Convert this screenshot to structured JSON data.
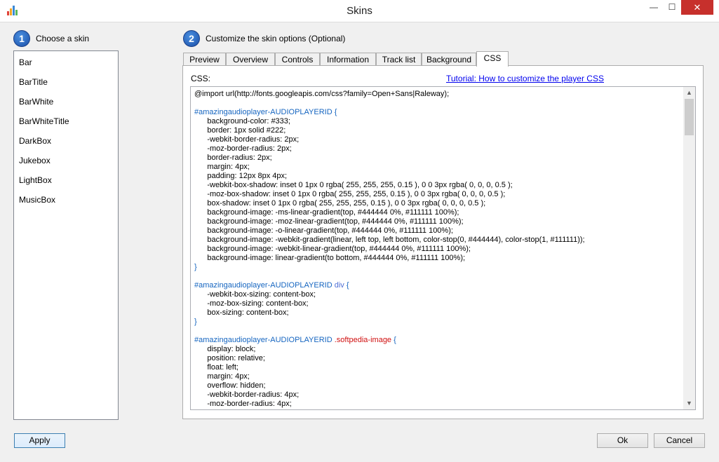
{
  "window": {
    "title": "Skins",
    "controls": {
      "minimize": "—",
      "maximize": "☐",
      "close": "✕"
    },
    "accent": "#c7302c"
  },
  "step1": {
    "number": "1",
    "label": "Choose a skin"
  },
  "step2": {
    "number": "2",
    "label": "Customize the skin options (Optional)"
  },
  "skins": [
    "Bar",
    "BarTitle",
    "BarWhite",
    "BarWhiteTitle",
    "DarkBox",
    "Jukebox",
    "LightBox",
    "MusicBox"
  ],
  "tabs": [
    {
      "label": "Preview"
    },
    {
      "label": "Overview"
    },
    {
      "label": "Controls"
    },
    {
      "label": "Information"
    },
    {
      "label": "Track list"
    },
    {
      "label": "Background"
    },
    {
      "label": "CSS",
      "active": true
    }
  ],
  "css_panel": {
    "label": "CSS:",
    "tutorial_link": "Tutorial: How to customize the player CSS",
    "code_lines": [
      "@import url(http://fonts.googleapis.com/css?family=Open+Sans|Raleway);",
      "",
      "#amazingaudioplayer-AUDIOPLAYERID {",
      "      background-color: #333;",
      "      border: 1px solid #222;",
      "      -webkit-border-radius: 2px;",
      "      -moz-border-radius: 2px;",
      "      border-radius: 2px;",
      "      margin: 4px;",
      "      padding: 12px 8px 4px;",
      "      -webkit-box-shadow: inset 0 1px 0 rgba( 255, 255, 255, 0.15 ), 0 0 3px rgba( 0, 0, 0, 0.5 );",
      "      -moz-box-shadow: inset 0 1px 0 rgba( 255, 255, 255, 0.15 ), 0 0 3px rgba( 0, 0, 0, 0.5 );",
      "      box-shadow: inset 0 1px 0 rgba( 255, 255, 255, 0.15 ), 0 0 3px rgba( 0, 0, 0, 0.5 );",
      "      background-image: -ms-linear-gradient(top, #444444 0%, #111111 100%);",
      "      background-image: -moz-linear-gradient(top, #444444 0%, #111111 100%);",
      "      background-image: -o-linear-gradient(top, #444444 0%, #111111 100%);",
      "      background-image: -webkit-gradient(linear, left top, left bottom, color-stop(0, #444444), color-stop(1, #111111));",
      "      background-image: -webkit-linear-gradient(top, #444444 0%, #111111 100%);",
      "      background-image: linear-gradient(to bottom, #444444 0%, #111111 100%);",
      "}",
      "",
      "#amazingaudioplayer-AUDIOPLAYERID div {",
      "      -webkit-box-sizing: content-box;",
      "      -moz-box-sizing: content-box;",
      "      box-sizing: content-box;",
      "}",
      "",
      "#amazingaudioplayer-AUDIOPLAYERID .softpedia-image {",
      "      display: block;",
      "      position: relative;",
      "      float: left;",
      "      margin: 4px;",
      "      overflow: hidden;",
      "      -webkit-border-radius: 4px;",
      "      -moz-border-radius: 4px;"
    ]
  },
  "buttons": {
    "apply": "Apply",
    "ok": "Ok",
    "cancel": "Cancel"
  }
}
